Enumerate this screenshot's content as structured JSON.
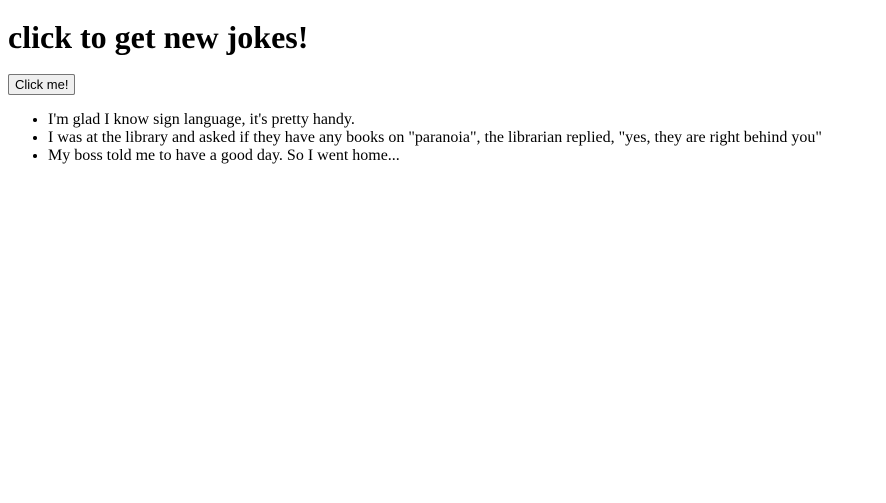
{
  "heading": "click to get new jokes!",
  "button_label": "Click me!",
  "jokes": [
    "I'm glad I know sign language, it's pretty handy.",
    "I was at the library and asked if they have any books on \"paranoia\", the librarian replied, \"yes, they are right behind you\"",
    "My boss told me to have a good day. So I went home..."
  ]
}
